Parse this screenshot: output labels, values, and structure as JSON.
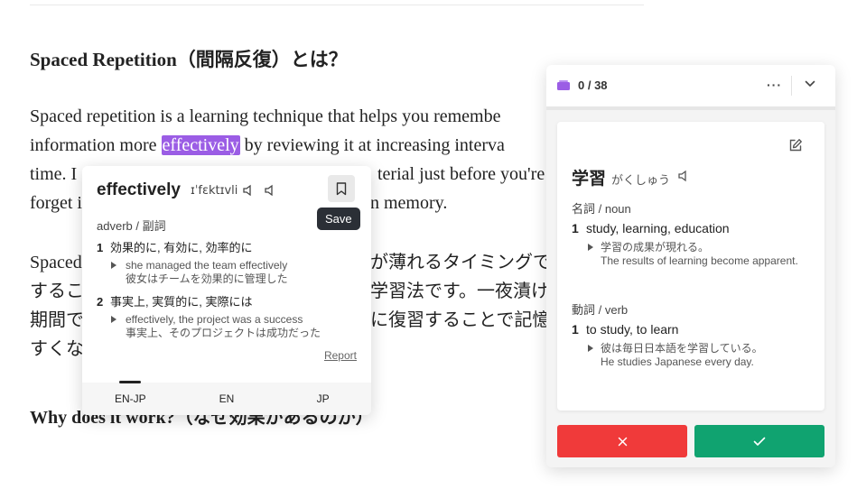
{
  "article": {
    "heading1": "Spaced Repetition（間隔反復）とは？",
    "p1": {
      "l1": "Spaced repetition is a learning technique that helps you remembe",
      "l2_pre": "information more ",
      "l2_hl": "effectively",
      "l2_post": " by reviewing it at increasing interva",
      "l3a": "time. I",
      "l3b": "terial just before you're",
      "l4a": "forget i",
      "l4b": "n memory."
    },
    "p2": {
      "l1a": "Spaced",
      "l1b": "が薄れるタイミングで",
      "l2a": "するこ",
      "l2b": "学習法です。一夜漬け",
      "l3a": "期間で",
      "l3b": "に復習することで記憶",
      "l4a": "すくな"
    },
    "heading2": "Why does it work?（なぜ効果があるのか）"
  },
  "popup": {
    "word": "effectively",
    "ipa": "ɪˈfɛktɪvli",
    "save_label": "Save",
    "pos": "adverb / 副詞",
    "senses": [
      {
        "num": "1",
        "gloss": "効果的に, 有効に, 効率的に",
        "example_en": "she managed the team effectively",
        "example_ja": "彼女はチームを効果的に管理した"
      },
      {
        "num": "2",
        "gloss": "事実上, 実質的に, 実際には",
        "example_en": "effectively, the project was a success",
        "example_ja": "事実上、そのプロジェクトは成功だった"
      }
    ],
    "report_label": "Report",
    "tabs": [
      "EN-JP",
      "EN",
      "JP"
    ]
  },
  "flashcard": {
    "count": "0 / 38",
    "word": "学習",
    "reading": "がくしゅう",
    "noun_pos": "名詞 / noun",
    "noun_sense": {
      "num": "1",
      "gloss": "study, learning, education",
      "example_ja": "学習の成果が現れる。",
      "example_en": "The results of learning become apparent."
    },
    "verb_pos": "動詞 / verb",
    "verb_sense": {
      "num": "1",
      "gloss": "to study, to learn",
      "example_ja": "彼は毎日日本語を学習している。",
      "example_en": "He studies Japanese every day."
    },
    "more_label": "···"
  },
  "colors": {
    "highlight": "#9b5de5",
    "wrong": "#f03a3a",
    "right": "#10a370",
    "deck_icon": "#9b5de5"
  }
}
